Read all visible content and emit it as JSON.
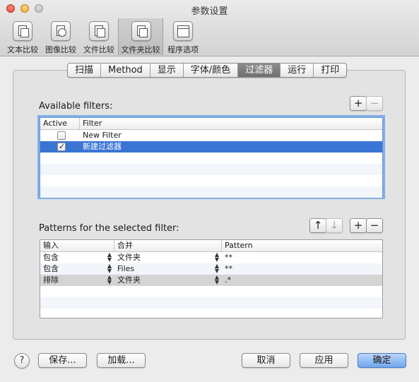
{
  "window": {
    "title": "参数设置"
  },
  "toolbar": {
    "items": [
      {
        "label": "文本比较",
        "icon": "text-compare-icon"
      },
      {
        "label": "图像比较",
        "icon": "image-compare-icon"
      },
      {
        "label": "文件比较",
        "icon": "file-compare-icon"
      },
      {
        "label": "文件夹比较",
        "icon": "folder-compare-icon",
        "selected": true
      },
      {
        "label": "程序选项",
        "icon": "app-options-icon"
      }
    ]
  },
  "tabs": [
    {
      "label": "扫描"
    },
    {
      "label": "Method"
    },
    {
      "label": "显示"
    },
    {
      "label": "字体/颜色"
    },
    {
      "label": "过滤器",
      "active": true
    },
    {
      "label": "运行"
    },
    {
      "label": "打印"
    }
  ],
  "filters": {
    "section_label": "Available filters:",
    "add": "+",
    "remove": "−",
    "columns": {
      "active": "Active",
      "filter": "Filter"
    },
    "rows": [
      {
        "active": false,
        "name": "New Filter"
      },
      {
        "active": true,
        "name": "新建过滤器"
      }
    ]
  },
  "patterns": {
    "section_label": "Patterns for the selected filter:",
    "up": "↑",
    "down": "↓",
    "add": "+",
    "remove": "−",
    "columns": {
      "input": "输入",
      "merge": "合并",
      "pattern": "Pattern"
    },
    "rows": [
      {
        "input": "包含",
        "merge": "文件夹",
        "pattern": "**"
      },
      {
        "input": "包含",
        "merge": "Files",
        "pattern": "**"
      },
      {
        "input": "排除",
        "merge": "文件夹",
        "pattern": ".*"
      }
    ]
  },
  "buttons": {
    "help": "?",
    "save": "保存...",
    "load": "加载...",
    "cancel": "取消",
    "apply": "应用",
    "ok": "确定"
  },
  "colors": {
    "selection": "#3a75d3",
    "default_button": "#6fa6ee",
    "focus_ring": "#83aee6"
  }
}
